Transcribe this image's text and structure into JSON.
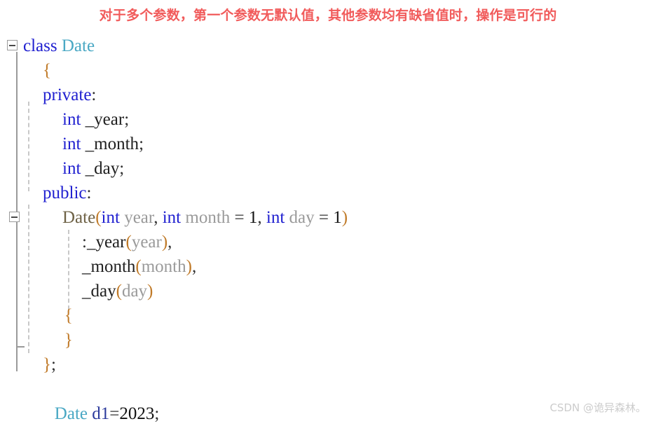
{
  "title": {
    "text": "对于多个参数，第一个参数无默认值，其他参数均有缺省值时，操作是可行的",
    "color": "#f15b5b"
  },
  "watermark": {
    "text": "CSDN @诡异森林。"
  },
  "editor": {
    "language": "C++",
    "fold_markers": [
      {
        "name": "fold-class-date",
        "state": "expanded",
        "glyph": "−"
      },
      {
        "name": "fold-constructor-date",
        "state": "expanded",
        "glyph": "−"
      }
    ],
    "lines": [
      {
        "name": "line-class-date",
        "indent": 0,
        "tokens": [
          {
            "t": "class",
            "c": "kw"
          },
          {
            "t": " ",
            "c": "punct"
          },
          {
            "t": "Date",
            "c": "type"
          }
        ]
      },
      {
        "name": "line-class-open-brace",
        "indent": 1,
        "tokens": [
          {
            "t": "{",
            "c": "brace"
          }
        ]
      },
      {
        "name": "line-private-label",
        "indent": 1,
        "tokens": [
          {
            "t": "private",
            "c": "kw"
          },
          {
            "t": ":",
            "c": "punct"
          }
        ]
      },
      {
        "name": "line-member-year",
        "indent": 2,
        "tokens": [
          {
            "t": "int",
            "c": "kw"
          },
          {
            "t": " ",
            "c": "punct"
          },
          {
            "t": "_year",
            "c": "ident"
          },
          {
            "t": ";",
            "c": "punct"
          }
        ]
      },
      {
        "name": "line-member-month",
        "indent": 2,
        "tokens": [
          {
            "t": "int",
            "c": "kw"
          },
          {
            "t": " ",
            "c": "punct"
          },
          {
            "t": "_month",
            "c": "ident"
          },
          {
            "t": ";",
            "c": "punct"
          }
        ]
      },
      {
        "name": "line-member-day",
        "indent": 2,
        "tokens": [
          {
            "t": "int",
            "c": "kw"
          },
          {
            "t": " ",
            "c": "punct"
          },
          {
            "t": "_day",
            "c": "ident"
          },
          {
            "t": ";",
            "c": "punct"
          }
        ]
      },
      {
        "name": "line-public-label",
        "indent": 1,
        "tokens": [
          {
            "t": "public",
            "c": "kw"
          },
          {
            "t": ":",
            "c": "punct"
          }
        ]
      },
      {
        "name": "line-constructor-signature",
        "indent": 2,
        "tokens": [
          {
            "t": "Date",
            "c": "ctor"
          },
          {
            "t": "(",
            "c": "paren"
          },
          {
            "t": "int",
            "c": "kw"
          },
          {
            "t": " ",
            "c": "punct"
          },
          {
            "t": "year",
            "c": "param"
          },
          {
            "t": ", ",
            "c": "punct"
          },
          {
            "t": "int",
            "c": "kw"
          },
          {
            "t": " ",
            "c": "punct"
          },
          {
            "t": "month",
            "c": "param"
          },
          {
            "t": " = ",
            "c": "punct"
          },
          {
            "t": "1",
            "c": "num"
          },
          {
            "t": ", ",
            "c": "punct"
          },
          {
            "t": "int",
            "c": "kw"
          },
          {
            "t": " ",
            "c": "punct"
          },
          {
            "t": "day",
            "c": "param"
          },
          {
            "t": " = ",
            "c": "punct"
          },
          {
            "t": "1",
            "c": "num"
          },
          {
            "t": ")",
            "c": "paren"
          }
        ]
      },
      {
        "name": "line-init-year",
        "indent": 3,
        "tokens": [
          {
            "t": ":",
            "c": "punct"
          },
          {
            "t": "_year",
            "c": "ident"
          },
          {
            "t": "(",
            "c": "paren"
          },
          {
            "t": "year",
            "c": "param"
          },
          {
            "t": ")",
            "c": "paren"
          },
          {
            "t": ",",
            "c": "punct"
          }
        ]
      },
      {
        "name": "line-init-month",
        "indent": 3,
        "tokens": [
          {
            "t": "_month",
            "c": "ident"
          },
          {
            "t": "(",
            "c": "paren"
          },
          {
            "t": "month",
            "c": "param"
          },
          {
            "t": ")",
            "c": "paren"
          },
          {
            "t": ",",
            "c": "punct"
          }
        ]
      },
      {
        "name": "line-init-day",
        "indent": 3,
        "tokens": [
          {
            "t": "_day",
            "c": "ident"
          },
          {
            "t": "(",
            "c": "paren"
          },
          {
            "t": "day",
            "c": "param"
          },
          {
            "t": ")",
            "c": "paren"
          }
        ]
      },
      {
        "name": "line-constructor-open-brace",
        "indent": 2.1,
        "tokens": [
          {
            "t": "{",
            "c": "brace"
          }
        ]
      },
      {
        "name": "line-constructor-close-brace",
        "indent": 2.1,
        "tokens": [
          {
            "t": "}",
            "c": "brace"
          }
        ]
      },
      {
        "name": "line-class-close-brace",
        "indent": 1,
        "tokens": [
          {
            "t": "}",
            "c": "brace"
          },
          {
            "t": ";",
            "c": "punct"
          }
        ]
      },
      {
        "name": "line-blank",
        "indent": 1,
        "tokens": []
      },
      {
        "name": "line-usage-declaration",
        "indent": 1.6,
        "tokens": [
          {
            "t": "Date",
            "c": "type"
          },
          {
            "t": " ",
            "c": "punct"
          },
          {
            "t": "d1",
            "c": "var"
          },
          {
            "t": "=",
            "c": "punct"
          },
          {
            "t": "2023",
            "c": "num"
          },
          {
            "t": ";",
            "c": "punct"
          }
        ]
      }
    ]
  }
}
